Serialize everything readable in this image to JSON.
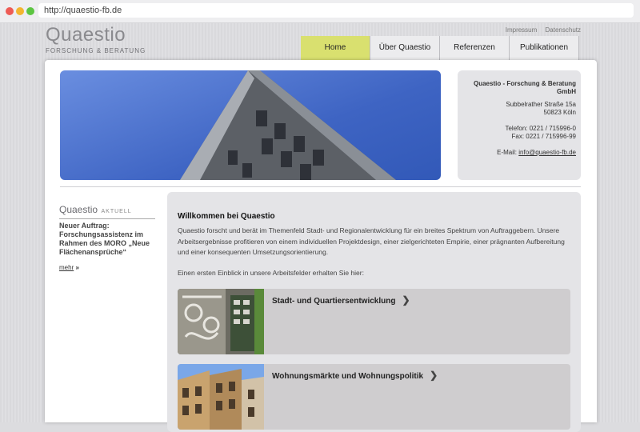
{
  "browser": {
    "url": "http://quaestio-fb.de"
  },
  "logo": {
    "word": "Quaestio",
    "subtitle": "FORSCHUNG & BERATUNG"
  },
  "top_links": [
    "Impressum",
    "Datenschutz"
  ],
  "nav": [
    {
      "label": "Home",
      "active": true
    },
    {
      "label": "Über Quaestio",
      "active": false
    },
    {
      "label": "Referenzen",
      "active": false
    },
    {
      "label": "Publikationen",
      "active": false
    }
  ],
  "contact": {
    "name_line1": "Quaestio - Forschung & Beratung",
    "name_line2": "GmbH",
    "street": "Subbelrather Straße 15a",
    "city": "50823 Köln",
    "phone": "Telefon: 0221 / 715996-0",
    "fax": "Fax: 0221 / 715996-99",
    "email_label": "E-Mail:",
    "email": "info@quaestio-fb.de"
  },
  "news": {
    "heading_word": "Quaestio",
    "heading_suffix": "AKTUELL",
    "title": "Neuer Auftrag: Forschungsassistenz im Rahmen des MORO „Neue Flächenansprüche“",
    "more": "mehr",
    "more_arrow": "»"
  },
  "welcome": {
    "title": "Willkommen bei Quaestio",
    "text": "Quaestio forscht und berät im Themenfeld Stadt- und Regionalentwicklung für ein breites Spektrum von Auftraggebern. Unsere Arbeitsergebnisse profitieren von einem individuellen Projektdesign, einer zielgerichteten Empirie, einer prägnanten Aufbereitung und einer konsequenten Umsetzungsorientierung.",
    "text2": "Einen ersten Einblick in unsere Arbeitsfelder erhalten Sie hier:"
  },
  "cards": [
    {
      "label": "Stadt- und Quartiersentwicklung",
      "icon": "chevron-right-icon"
    },
    {
      "label": "Wohnungsmärkte und Wohnungspolitik",
      "icon": "chevron-right-icon"
    }
  ],
  "colors": {
    "nav_active": "#d9e06f",
    "panel": "#e4e4e7",
    "card": "#cfcdcf"
  }
}
